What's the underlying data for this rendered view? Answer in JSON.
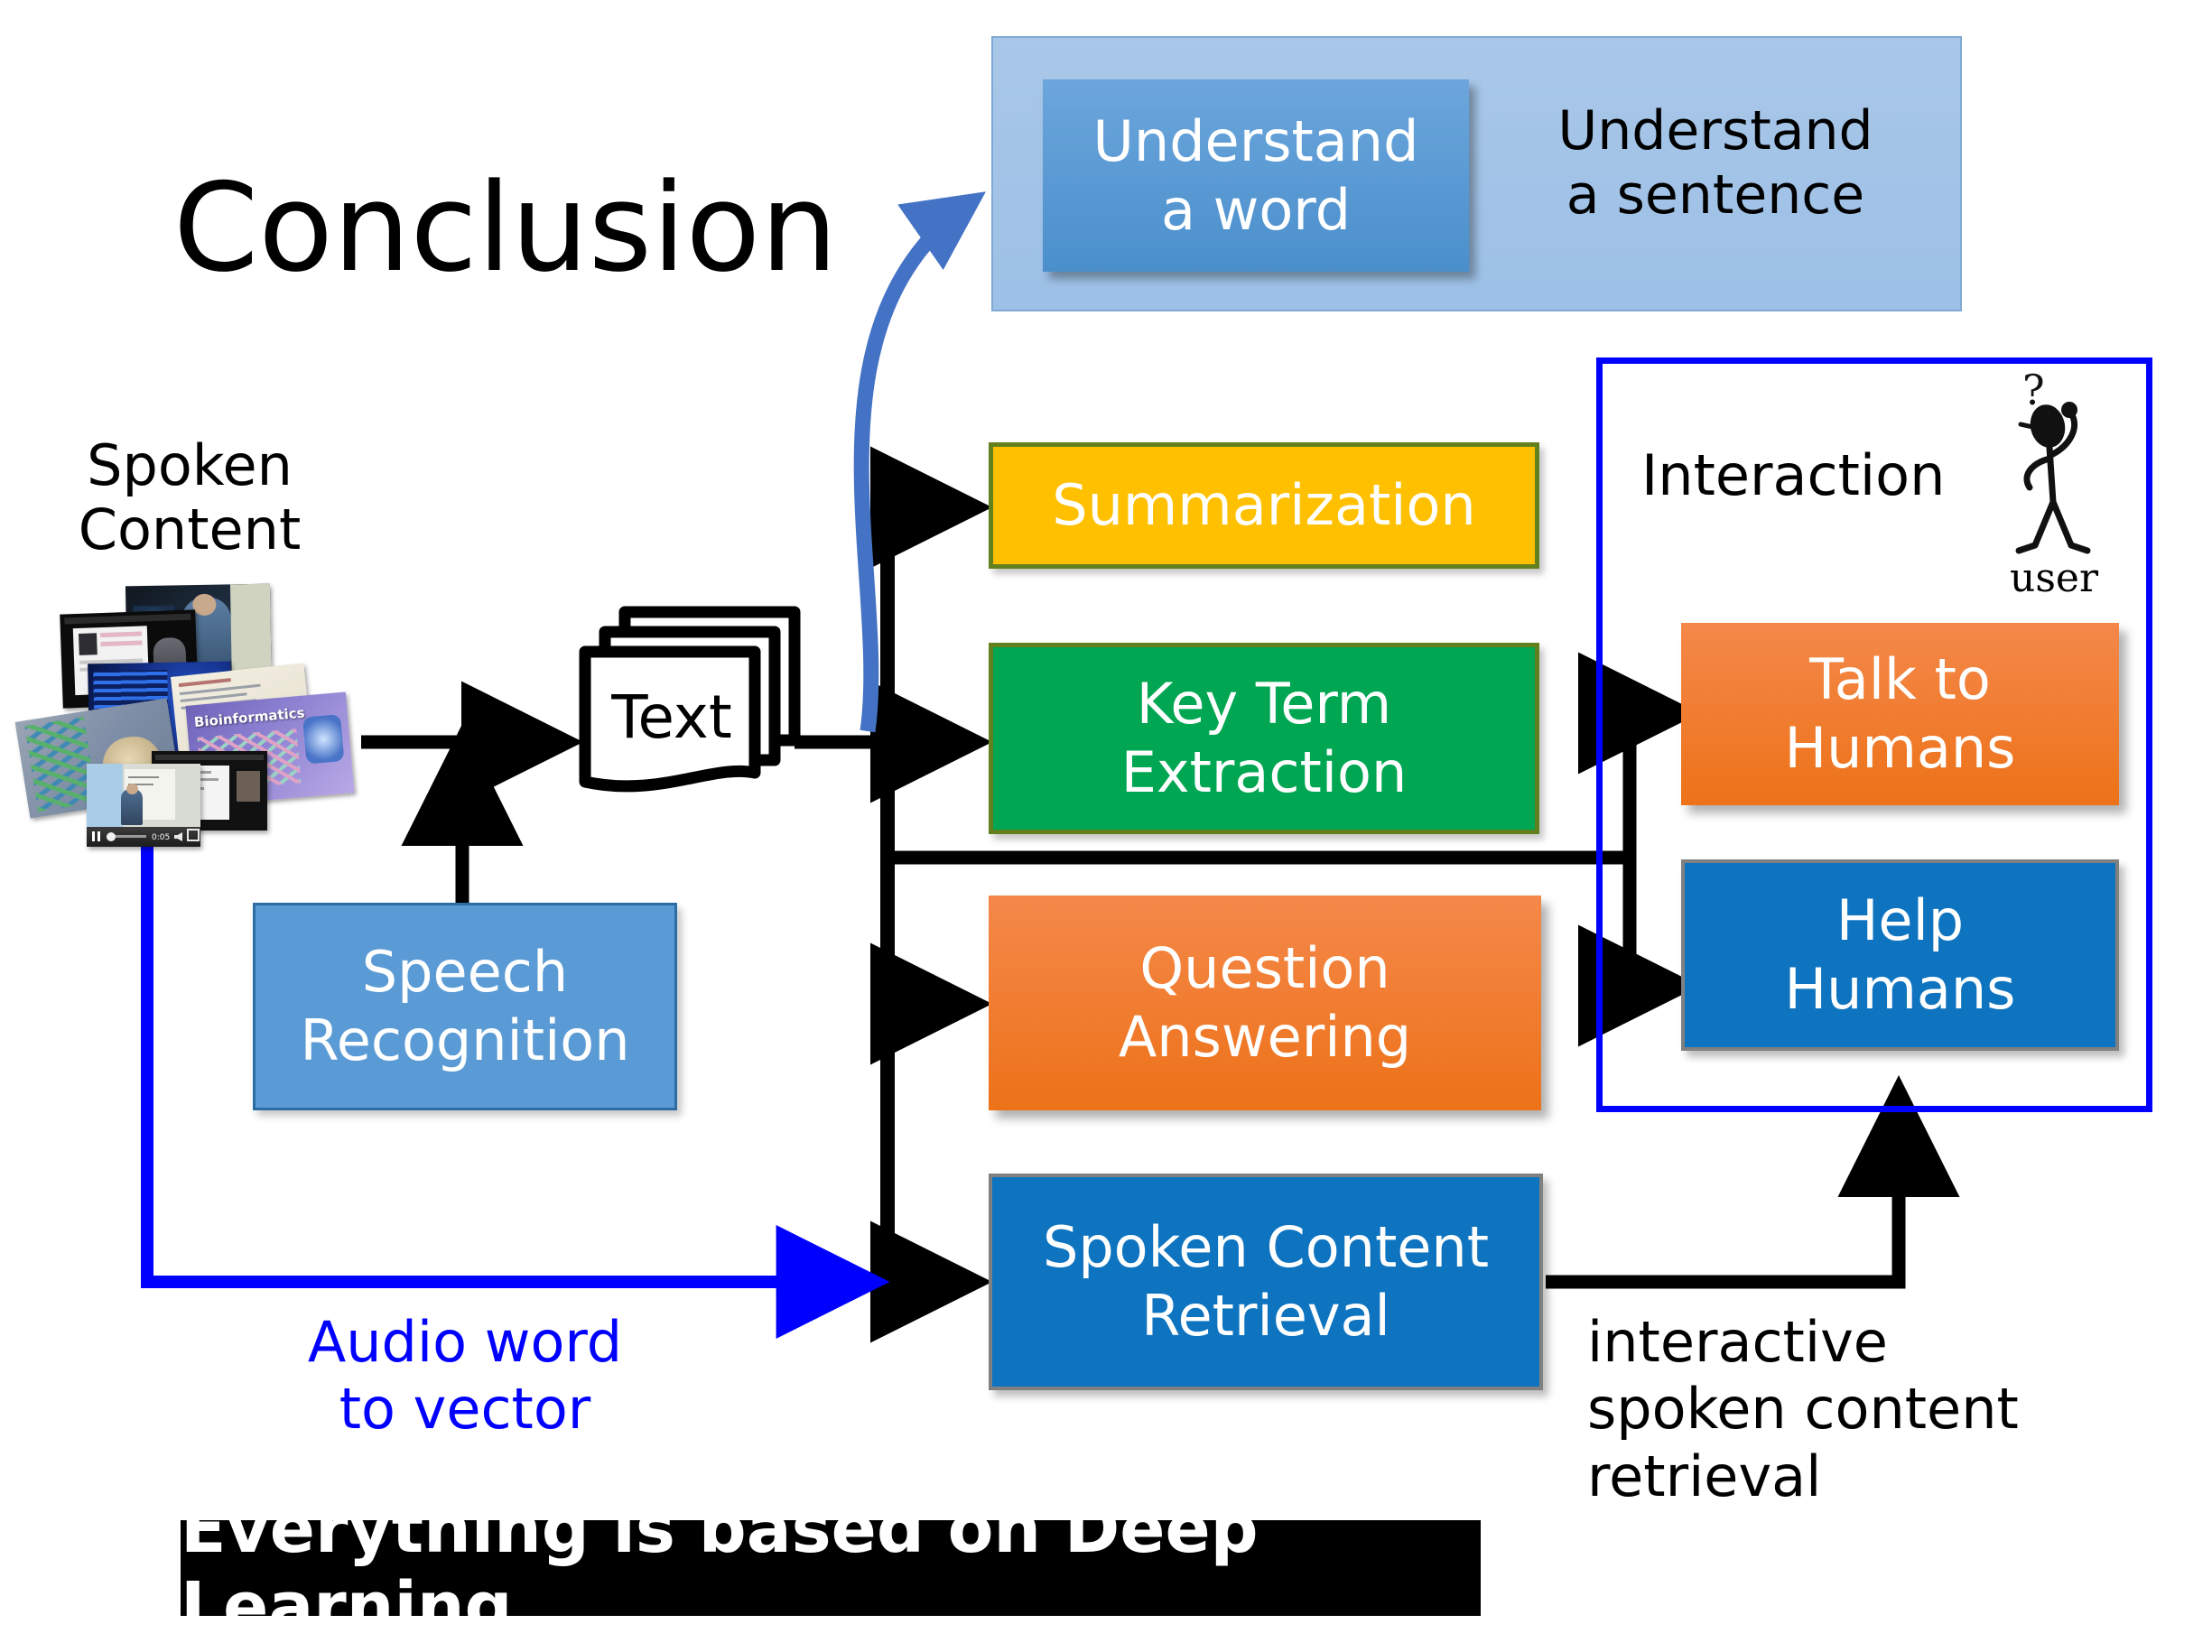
{
  "slide": {
    "title": "Conclusion",
    "banner": "Everything is based on Deep Learning"
  },
  "understanding_panel": {
    "word_box": "Understand\na word",
    "word_box_line1": "Understand",
    "word_box_line2": "a word",
    "sentence_line1": "Understand",
    "sentence_line2": "a sentence"
  },
  "input": {
    "label_line1": "Spoken",
    "label_line2": "Content",
    "media_player_time": "0:05",
    "thumbnail_caption": "Bioinformatics"
  },
  "pipeline": {
    "text_node": "Text",
    "speech_recognition_line1": "Speech",
    "speech_recognition_line2": "Recognition",
    "audio_path_line1": "Audio word",
    "audio_path_line2": "to vector"
  },
  "tasks": [
    {
      "id": "summarization",
      "label": "Summarization",
      "line1": "Summarization",
      "line2": "",
      "color": "#FFC000",
      "border": "#62801E"
    },
    {
      "id": "key-term",
      "label": "Key Term Extraction",
      "line1": "Key Term",
      "line2": "Extraction",
      "color": "#00A651",
      "border": "#62801E"
    },
    {
      "id": "question-answering",
      "label": "Question Answering",
      "line1": "Question",
      "line2": "Answering",
      "color": "#ED7218",
      "border": ""
    },
    {
      "id": "spoken-content-retrieval",
      "label": "Spoken Content Retrieval",
      "line1": "Spoken Content",
      "line2": "Retrieval",
      "color": "#0F74C0",
      "border": "#808080"
    }
  ],
  "interaction": {
    "title": "Interaction",
    "user_label": "user",
    "user_question_mark": "?",
    "boxes": [
      {
        "id": "talk-to-humans",
        "line1": "Talk to",
        "line2": "Humans",
        "color": "#ED7218"
      },
      {
        "id": "help-humans",
        "line1": "Help",
        "line2": "Humans",
        "color": "#0F74C0"
      }
    ]
  },
  "annotations": {
    "interactive_scr_line1": "interactive",
    "interactive_scr_line2": "spoken content",
    "interactive_scr_line3": "retrieval"
  },
  "colors": {
    "accent_blue": "#0000FF",
    "curve_blue": "#4472C4",
    "light_panel": "#A9C7E8",
    "amber": "#FFC000",
    "green": "#00A651",
    "orange": "#ED7218",
    "strong_blue": "#0F74C0",
    "speech_blue": "#5B9BD5",
    "black": "#000000"
  }
}
